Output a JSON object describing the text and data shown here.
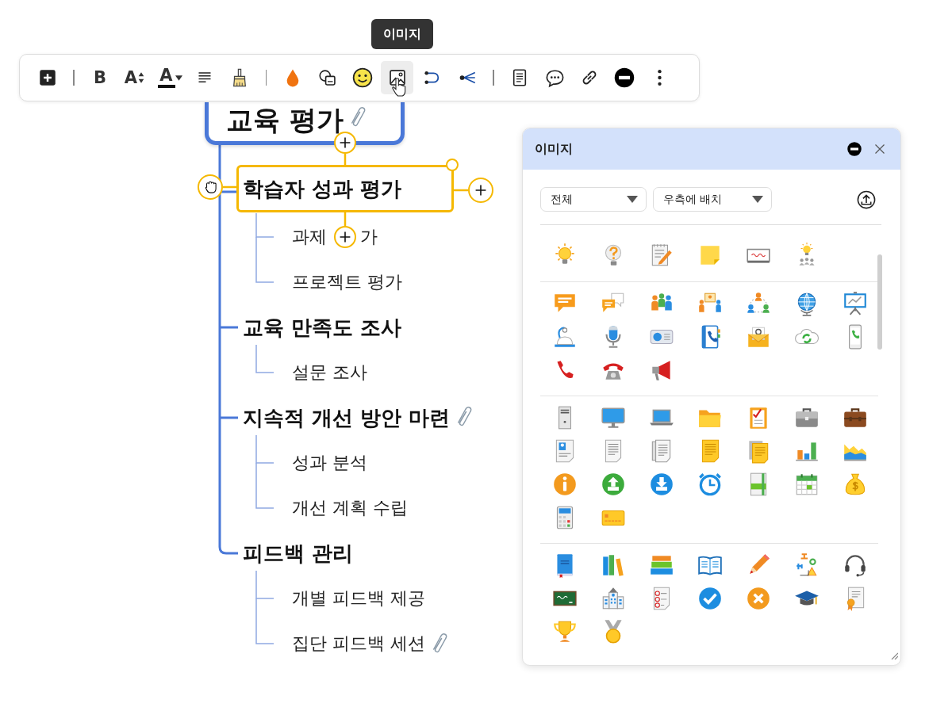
{
  "tooltip": {
    "text": "이미지"
  },
  "toolbar": {
    "groups": [
      [
        {
          "kind": "add",
          "hovered": false
        }
      ],
      [
        {
          "kind": "bold",
          "label": "B",
          "hovered": false
        },
        {
          "kind": "fontsize",
          "label": "A",
          "hovered": false
        },
        {
          "kind": "fontcolor",
          "label": "A",
          "hovered": false
        },
        {
          "kind": "align",
          "hovered": false
        },
        {
          "kind": "painter",
          "hovered": false
        }
      ],
      [
        {
          "kind": "fill",
          "hovered": false
        },
        {
          "kind": "shape",
          "hovered": false
        },
        {
          "kind": "emoji",
          "hovered": false
        },
        {
          "kind": "image",
          "hovered": true
        },
        {
          "kind": "relation",
          "hovered": false
        },
        {
          "kind": "summary",
          "hovered": false
        }
      ],
      [
        {
          "kind": "note",
          "hovered": false
        },
        {
          "kind": "comment",
          "hovered": false
        },
        {
          "kind": "link",
          "hovered": false
        },
        {
          "kind": "remove",
          "hovered": false
        },
        {
          "kind": "more",
          "hovered": false
        }
      ]
    ]
  },
  "mindmap": {
    "root": {
      "text": "교육 평가",
      "attachment": true,
      "selected": false
    },
    "topics": [
      {
        "text": "학습자 성과 평가",
        "attachment": false,
        "selected": true,
        "children": [
          {
            "parts": [
              "과제",
              "가"
            ],
            "attachment": false,
            "selected": false
          },
          {
            "text": "프로젝트 평가",
            "attachment": false,
            "selected": false
          }
        ]
      },
      {
        "text": "교육 만족도 조사",
        "attachment": false,
        "selected": false,
        "children": [
          {
            "text": "설문 조사",
            "attachment": false,
            "selected": false
          }
        ]
      },
      {
        "text": "지속적 개선 방안 마련",
        "attachment": true,
        "selected": false,
        "children": [
          {
            "text": "성과 분석",
            "attachment": false,
            "selected": false
          },
          {
            "text": "개선 계획 수립",
            "attachment": false,
            "selected": false
          }
        ]
      },
      {
        "text": "피드백 관리",
        "attachment": false,
        "selected": false,
        "children": [
          {
            "text": "개별 피드백 제공",
            "attachment": false,
            "selected": false
          },
          {
            "text": "집단 피드백 세션",
            "attachment": true,
            "selected": false
          }
        ]
      }
    ]
  },
  "panel": {
    "title": "이미지",
    "filters": [
      {
        "value": "전체"
      },
      {
        "value": "우측에 배치"
      }
    ]
  }
}
